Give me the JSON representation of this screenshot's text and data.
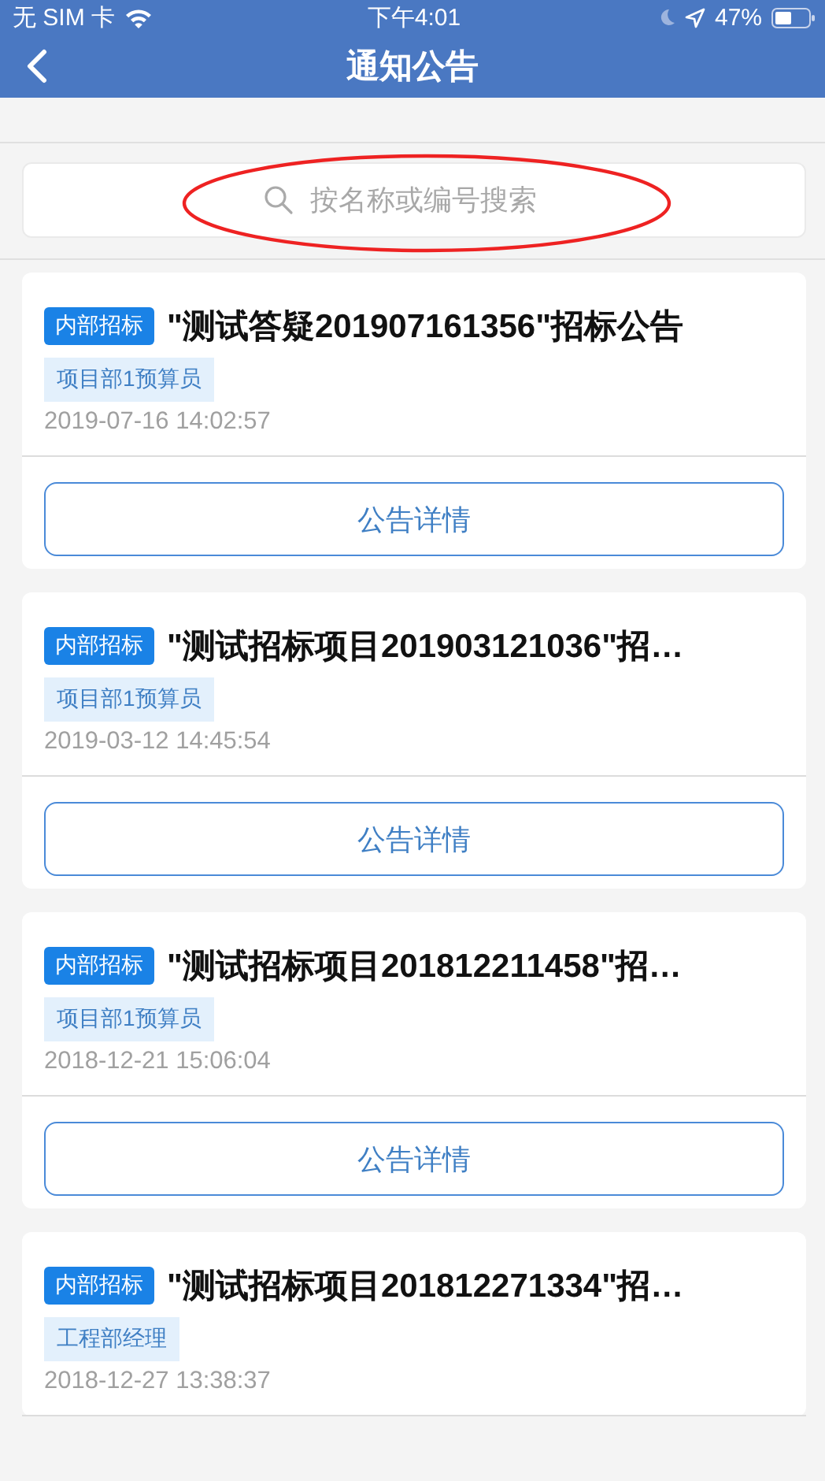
{
  "status_bar": {
    "carrier": "无 SIM 卡",
    "time": "下午4:01",
    "battery": "47%"
  },
  "nav_bar": {
    "title": "通知公告"
  },
  "search": {
    "placeholder": "按名称或编号搜索"
  },
  "notices": [
    {
      "badge": "内部招标",
      "title": "\"测试答疑201907161356\"招标公告",
      "role": "项目部1预算员",
      "date": "2019-07-16 14:02:57",
      "button": "公告详情"
    },
    {
      "badge": "内部招标",
      "title": "\"测试招标项目201903121036\"招…",
      "role": "项目部1预算员",
      "date": "2019-03-12 14:45:54",
      "button": "公告详情"
    },
    {
      "badge": "内部招标",
      "title": "\"测试招标项目201812211458\"招…",
      "role": "项目部1预算员",
      "date": "2018-12-21 15:06:04",
      "button": "公告详情"
    },
    {
      "badge": "内部招标",
      "title": "\"测试招标项目201812271334\"招…",
      "role": "工程部经理",
      "date": "2018-12-27 13:38:37"
    }
  ]
}
